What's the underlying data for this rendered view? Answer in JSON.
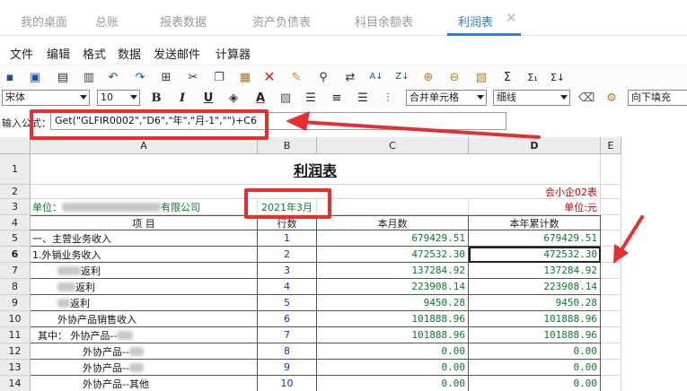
{
  "tabs": [
    {
      "label": "我的桌面"
    },
    {
      "label": "总账"
    },
    {
      "label": "报表数据"
    },
    {
      "label": "资产负债表"
    },
    {
      "label": "科目余额表"
    },
    {
      "label": "利润表",
      "active": true
    }
  ],
  "tab_close_glyph": "✕",
  "menu": [
    "文件",
    "编辑",
    "格式",
    "数据",
    "发送邮件",
    "计算器"
  ],
  "toolbar2": {
    "font": "宋体",
    "size": "10",
    "bold": "B",
    "italic": "I",
    "underline": "U",
    "font_color": "A",
    "merge": "合并单元格",
    "border": "细线",
    "fill_down": "向下填充"
  },
  "formula": {
    "label": "输入公式：",
    "value": "Get(\"GLFIR0002\",\"D6\",\"年\",\"月-1\",\"\")+C6"
  },
  "columns": [
    "A",
    "B",
    "C",
    "D",
    "E"
  ],
  "report": {
    "title": "利润表",
    "form_code": "会小企02表",
    "company_prefix": "单位：",
    "company_suffix": "有限公司",
    "period": "2021年3月",
    "unit": "单位:元",
    "header_item": "项    目",
    "header_no": "行数",
    "header_month": "本月数",
    "header_ytd": "本年累计数",
    "rows": [
      {
        "row": "5",
        "item": "一、主营业务收入",
        "no": "1",
        "month": "679429.51",
        "ytd": "679429.51"
      },
      {
        "row": "6",
        "item": "1.外销业务收入",
        "no": "2",
        "month": "472532.30",
        "ytd": "472532.30"
      },
      {
        "row": "7",
        "item_suffix": "返利",
        "no": "3",
        "month": "137284.92",
        "ytd": "137284.92"
      },
      {
        "row": "8",
        "item_suffix": "返利",
        "no": "4",
        "month": "223908.14",
        "ytd": "223908.14"
      },
      {
        "row": "9",
        "item_suffix": "返利",
        "no": "5",
        "month": "9450.28",
        "ytd": "9450.28"
      },
      {
        "row": "10",
        "item": "外协产品销售收入",
        "no": "6",
        "month": "101888.96",
        "ytd": "101888.96"
      },
      {
        "row": "11",
        "item": "其中：  外协产品--",
        "no": "7",
        "month": "101888.96",
        "ytd": "101888.96"
      },
      {
        "row": "12",
        "item": "外协产品--",
        "no": "8",
        "month": "0.00",
        "ytd": "0.00"
      },
      {
        "row": "13",
        "item": "外协产品--",
        "no": "9",
        "month": "0.00",
        "ytd": "0.00"
      },
      {
        "row": "14",
        "item": "外协产品--其他",
        "no": "10",
        "month": "0.00",
        "ytd": "0.00"
      }
    ]
  },
  "row_numbers": [
    "1",
    "2",
    "3",
    "4"
  ]
}
